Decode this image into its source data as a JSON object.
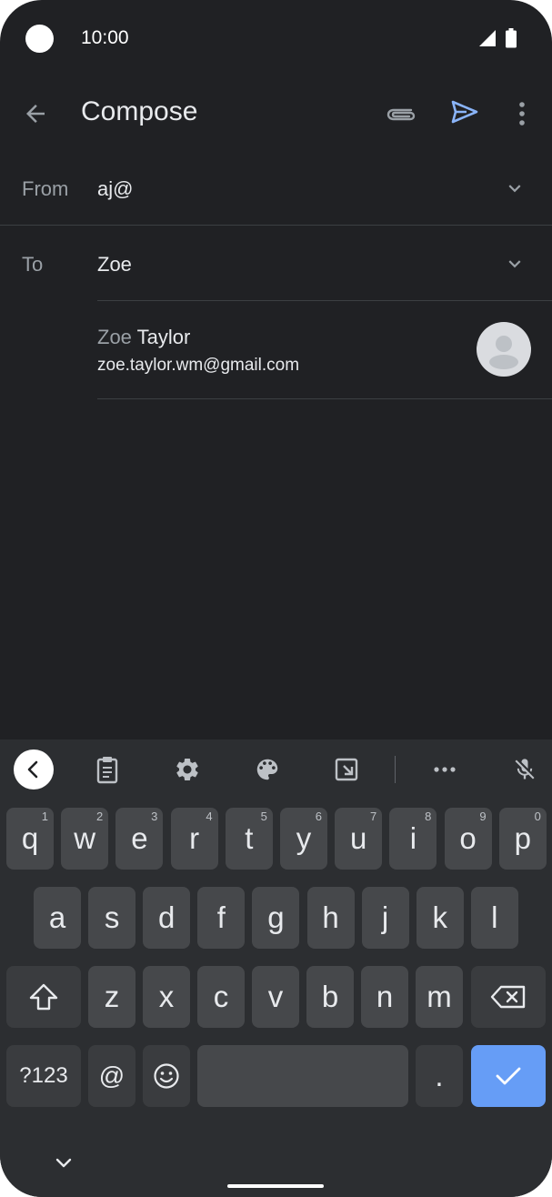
{
  "status_bar": {
    "time": "10:00"
  },
  "app_bar": {
    "title": "Compose"
  },
  "from": {
    "label": "From",
    "value": "aj@"
  },
  "to": {
    "label": "To",
    "value": "Zoe"
  },
  "suggestion": {
    "name_match": "Zoe",
    "name_rest": " Taylor",
    "email": "zoe.taylor.wm@gmail.com"
  },
  "keyboard": {
    "toolbar_icons": [
      "collapse-icon",
      "clipboard-icon",
      "gear-icon",
      "palette-icon",
      "resize-icon",
      "more-icon",
      "mic-off-icon"
    ],
    "row1": [
      {
        "k": "q",
        "h": "1"
      },
      {
        "k": "w",
        "h": "2"
      },
      {
        "k": "e",
        "h": "3"
      },
      {
        "k": "r",
        "h": "4"
      },
      {
        "k": "t",
        "h": "5"
      },
      {
        "k": "y",
        "h": "6"
      },
      {
        "k": "u",
        "h": "7"
      },
      {
        "k": "i",
        "h": "8"
      },
      {
        "k": "o",
        "h": "9"
      },
      {
        "k": "p",
        "h": "0"
      }
    ],
    "row2": [
      "a",
      "s",
      "d",
      "f",
      "g",
      "h",
      "j",
      "k",
      "l"
    ],
    "row3": [
      "z",
      "x",
      "c",
      "v",
      "b",
      "n",
      "m"
    ],
    "row4": {
      "symbols": "?123",
      "at": "@",
      "period": "."
    },
    "accent_color": "#669df6"
  }
}
